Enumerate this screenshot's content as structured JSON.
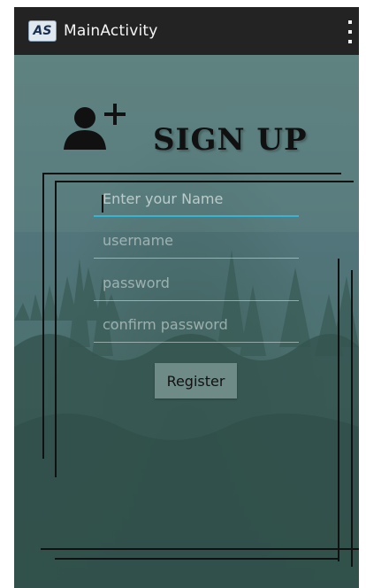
{
  "app_bar": {
    "icon_text": "AS",
    "title": "MainActivity",
    "overflow_icon": "three-dots-vertical-icon"
  },
  "header": {
    "icon": "add-user-icon",
    "title": "SIGN UP"
  },
  "form": {
    "name_placeholder": "Enter your Name",
    "username_placeholder": "username",
    "password_placeholder": "password",
    "confirm_placeholder": "confirm password",
    "register_label": "Register"
  },
  "colors": {
    "app_bar": "#232323",
    "background": "#4f7371",
    "accent": "#35b4d4",
    "button": "#6f8b87"
  }
}
